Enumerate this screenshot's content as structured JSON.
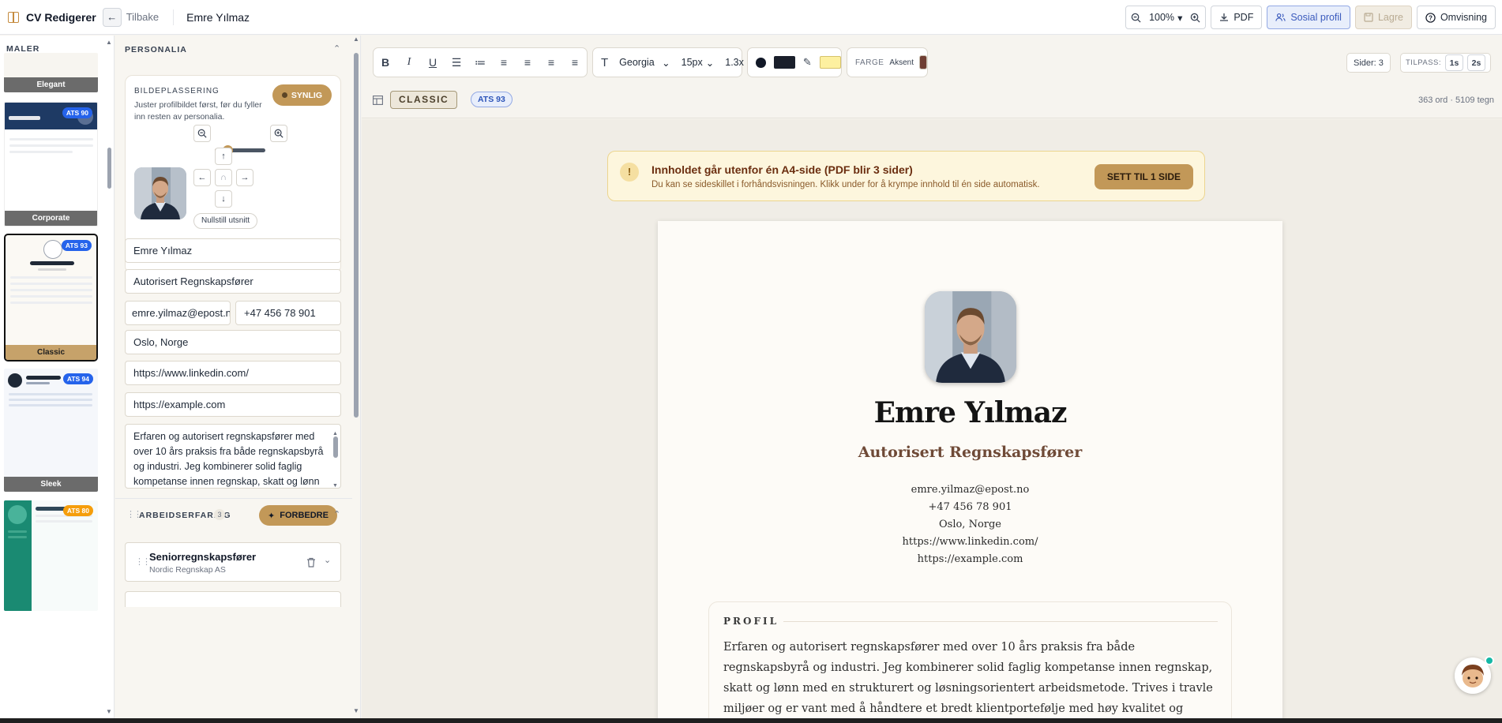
{
  "header": {
    "app_title": "CV Redigerer",
    "back_label": "Tilbake",
    "doc_title": "Emre Yılmaz",
    "zoom": "100%",
    "pdf": "PDF",
    "social": "Sosial profil",
    "save": "Lagre",
    "tour": "Omvisning"
  },
  "templates": {
    "heading": "MALER",
    "items": [
      {
        "name": "Elegant",
        "ats": ""
      },
      {
        "name": "Corporate",
        "ats": "ATS 90"
      },
      {
        "name": "Classic",
        "ats": "ATS 93"
      },
      {
        "name": "Sleek",
        "ats": "ATS 94"
      },
      {
        "name": "",
        "ats": "ATS 80"
      }
    ]
  },
  "form": {
    "section_title": "PERSONALIA",
    "photo": {
      "title": "BILDEPLASSERING",
      "description": "Juster profilbildet først, før du fyller inn resten av personalia.",
      "visible_label": "SYNLIG",
      "reset_label": "Nullstill utsnitt",
      "zoom_level": 0.2
    },
    "name": "Emre Yılmaz",
    "title": "Autorisert Regnskapsfører",
    "email": "emre.yilmaz@epost.no",
    "phone": "+47 456 78 901",
    "location": "Oslo, Norge",
    "linkedin": "https://www.linkedin.com/",
    "website": "https://example.com",
    "summary": "Erfaren og autorisert regnskapsfører med over 10 års praksis fra både regnskapsbyrå og industri. Jeg kombinerer solid faglig kompetanse innen regnskap, skatt og lønn med et strukturert og løsningsorientert arbeidsmetode.",
    "experience": {
      "title": "ARBEIDSERFARING",
      "count": "3",
      "improve_label": "FORBEDRE",
      "jobs": [
        {
          "title": "Seniorregnskapsfører",
          "company": "Nordic Regnskap AS"
        }
      ]
    }
  },
  "toolbar": {
    "font": "Georgia",
    "size": "15px",
    "line_height": "1.3x",
    "text_color": "#1a1f2b",
    "highlight_color": "#fdf0a0",
    "color_label": "FARGE",
    "accent_label": "Aksent",
    "accent_color": "#6f3e33",
    "pages": "Sider: 3",
    "fit_label": "TILPASS:",
    "fit_1": "1s",
    "fit_2": "2s",
    "template_chip": "CLASSIC",
    "ats_chip": "ATS 93",
    "word_count": "363 ord · 5109 tegn"
  },
  "warning": {
    "title": "Innholdet går utenfor én A4-side (PDF blir 3 sider)",
    "description": "Du kan se sideskillet i forhåndsvisningen. Klikk under for å krympe innhold til én side automatisk.",
    "button": "SETT TIL 1 SIDE"
  },
  "cv": {
    "name": "Emre Yılmaz",
    "title": "Autorisert Regnskapsfører",
    "email": "emre.yilmaz@epost.no",
    "phone": "+47 456 78 901",
    "location": "Oslo, Norge",
    "linkedin": "https://www.linkedin.com/",
    "website": "https://example.com",
    "profile_heading": "PROFIL",
    "profile_text": "Erfaren og autorisert regnskapsfører med over 10 års praksis fra både regnskapsbyrå og industri. Jeg kombinerer solid faglig kompetanse innen regnskap, skatt og lønn med en strukturert og løsningsorientert arbeidsmetode. Trives i travle miljøer og er vant med å håndtere et bredt klientportefølje med høy kvalitet og korte frister."
  }
}
